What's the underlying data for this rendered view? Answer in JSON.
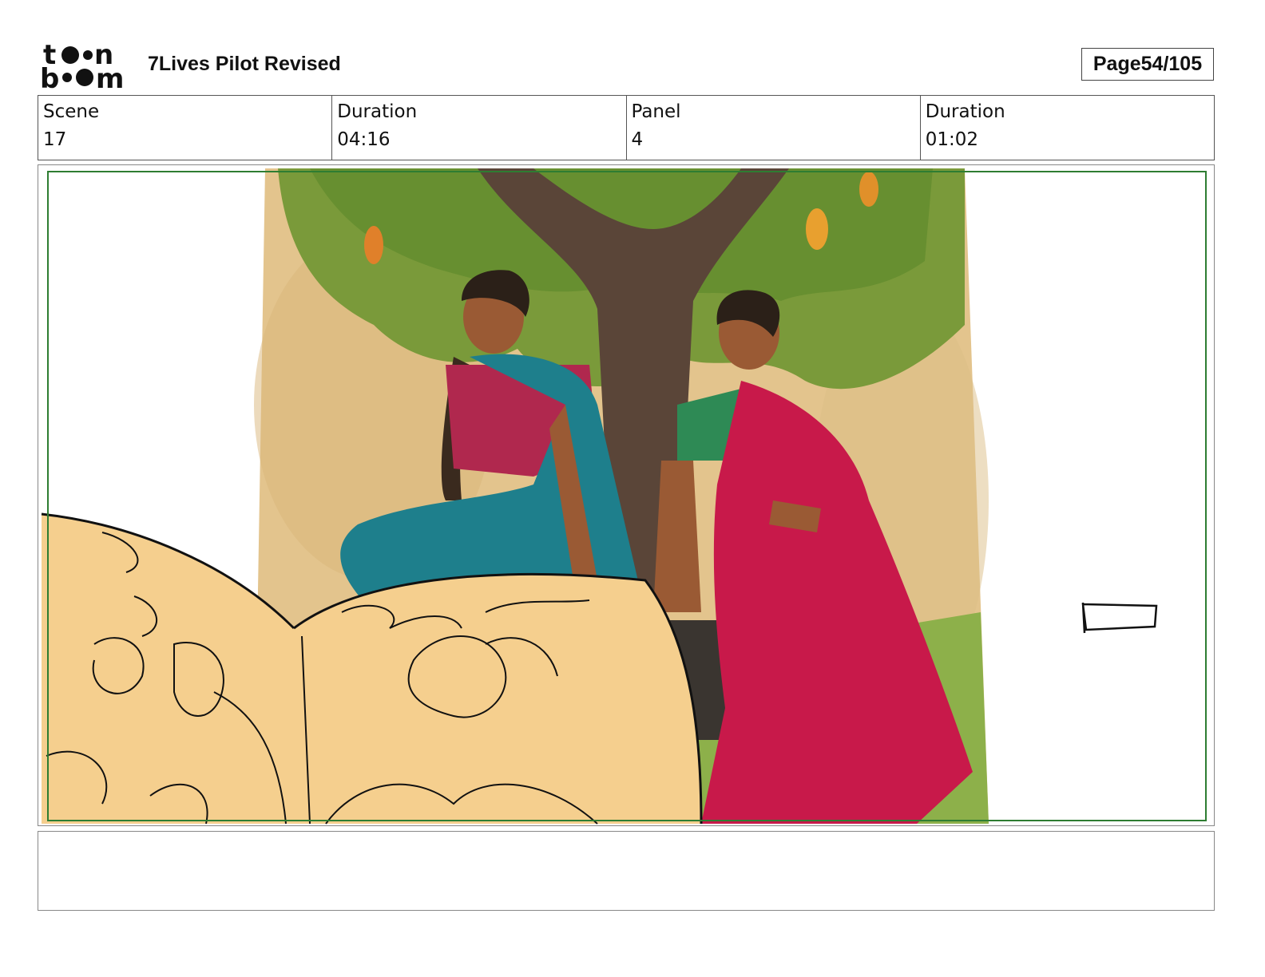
{
  "header": {
    "logo_text": "toonboom",
    "title": "7Lives Pilot Revised",
    "page_label": "Page",
    "page_value": "54/105"
  },
  "info": {
    "scene_label": "Scene",
    "scene_value": "17",
    "scene_duration_label": "Duration",
    "scene_duration_value": "04:16",
    "panel_label": "Panel",
    "panel_value": "4",
    "panel_duration_label": "Duration",
    "panel_duration_value": "01:02"
  },
  "panel": {
    "image_description_icon": "storyboard-panel-illustration",
    "camera_frame_color": "#2e7d32"
  },
  "notes": {
    "text": ""
  },
  "colors": {
    "sketch_fill": "#f5cf8e",
    "background_wash": "#e3c48d",
    "foliage": "#7a9a3a",
    "trunk": "#5a4538",
    "teal_sari": "#1e7f8c",
    "red_sari": "#c8194a",
    "grass": "#8db04a"
  }
}
